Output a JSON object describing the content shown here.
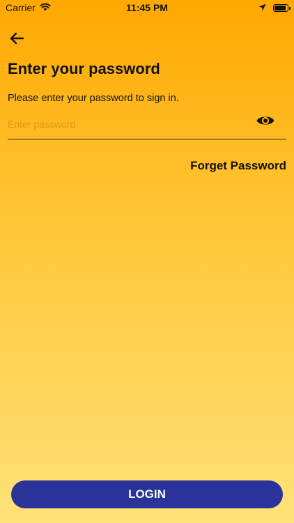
{
  "status_bar": {
    "carrier": "Carrier",
    "time": "11:45 PM"
  },
  "icons": {
    "back": "arrow-left",
    "wifi": "wifi",
    "location": "location-arrow",
    "battery": "battery-full",
    "visibility": "eye"
  },
  "header": {
    "title": "Enter your password",
    "subtitle": "Please enter your password to sign in."
  },
  "password": {
    "value": "",
    "placeholder": "Enter password"
  },
  "links": {
    "forget_password": "Forget Password"
  },
  "actions": {
    "login_label": "LOGIN"
  },
  "colors": {
    "gradient_top": "#FFA800",
    "gradient_bottom": "#FFE27A",
    "button": "#29339A",
    "placeholder": "#D99A15"
  }
}
